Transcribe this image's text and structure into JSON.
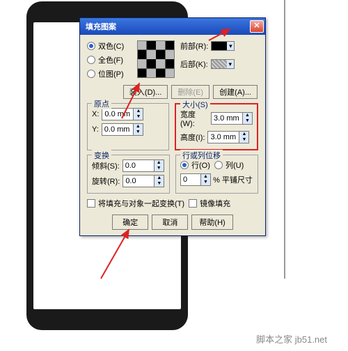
{
  "watermark": "脚本之家 jb51.net",
  "dialog": {
    "title": "填充图案",
    "radios": {
      "two": "双色(C)",
      "full": "全色(F)",
      "bitmap": "位图(P)"
    },
    "front_lbl": "前部(R):",
    "back_lbl": "后部(K):",
    "front_color": "#000000",
    "back_color": "#b8b8b8",
    "load": "装入(D)...",
    "delete": "删除(E)",
    "create": "创建(A)...",
    "origin": {
      "legend": "原点",
      "x_lbl": "X:",
      "x_val": "0.0 mm",
      "y_lbl": "Y:",
      "y_val": "0.0 mm"
    },
    "size": {
      "legend": "大小(S)",
      "w_lbl": "宽度(W):",
      "w_val": "3.0 mm",
      "h_lbl": "高度(I):",
      "h_val": "3.0 mm"
    },
    "transform": {
      "legend": "变换",
      "skew_lbl": "倾斜(S):",
      "skew_val": "0.0",
      "rot_lbl": "旋转(R):",
      "rot_val": "0.0"
    },
    "offset": {
      "legend": "行或列位移",
      "row": "行(O)",
      "col": "列(U)",
      "off_val": "0",
      "off_lbl": "% 平铺尺寸"
    },
    "with_fill": "将填充与对象一起变换(T)",
    "mirror": "镜像填充",
    "ok": "确定",
    "cancel": "取消",
    "help": "帮助(H)"
  }
}
